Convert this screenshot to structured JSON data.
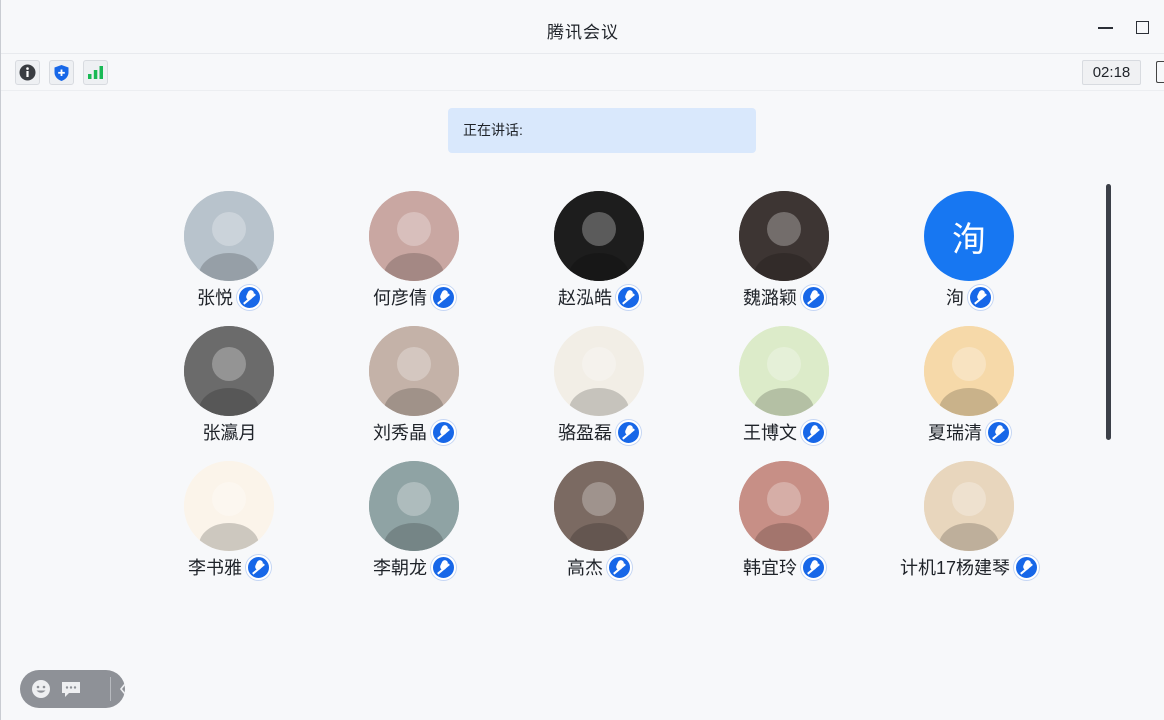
{
  "window": {
    "title": "腾讯会议"
  },
  "toolbar": {
    "info_icon": "info-icon",
    "shield_icon": "shield-icon",
    "signal_icon": "signal-bars-icon",
    "timer": "02:18"
  },
  "speaking": {
    "label": "正在讲话:"
  },
  "participants": [
    {
      "name": "张悦",
      "muted": true,
      "avatar_type": "image",
      "avatar_bg": "#b8c3cc"
    },
    {
      "name": "何彦倩",
      "muted": true,
      "avatar_type": "image",
      "avatar_bg": "#c9a7a2"
    },
    {
      "name": "赵泓皓",
      "muted": true,
      "avatar_type": "image",
      "avatar_bg": "#1d1d1d"
    },
    {
      "name": "魏潞颖",
      "muted": true,
      "avatar_type": "image",
      "avatar_bg": "#3d3533"
    },
    {
      "name": "洵",
      "muted": true,
      "avatar_type": "text",
      "avatar_text": "洵",
      "avatar_bg": "#1777f2"
    },
    {
      "name": "张瀛月",
      "muted": false,
      "avatar_type": "image",
      "avatar_bg": "#6b6b6b"
    },
    {
      "name": "刘秀晶",
      "muted": true,
      "avatar_type": "image",
      "avatar_bg": "#c4b2a8"
    },
    {
      "name": "骆盈磊",
      "muted": true,
      "avatar_type": "image",
      "avatar_bg": "#f2eee6"
    },
    {
      "name": "王博文",
      "muted": true,
      "avatar_type": "image",
      "avatar_bg": "#dcebc9"
    },
    {
      "name": "夏瑞清",
      "muted": true,
      "avatar_type": "image",
      "avatar_bg": "#f6d9a9"
    },
    {
      "name": "李书雅",
      "muted": true,
      "avatar_type": "image",
      "avatar_bg": "#fbf4ea"
    },
    {
      "name": "李朝龙",
      "muted": true,
      "avatar_type": "image",
      "avatar_bg": "#8fa3a4"
    },
    {
      "name": "高杰",
      "muted": true,
      "avatar_type": "image",
      "avatar_bg": "#7b6a62"
    },
    {
      "name": "韩宜玲",
      "muted": true,
      "avatar_type": "image",
      "avatar_bg": "#c78f86"
    },
    {
      "name": "计机17杨建琴",
      "muted": true,
      "avatar_type": "image",
      "avatar_bg": "#e8d6bd"
    }
  ],
  "bottom_bar": {
    "emoji_icon": "emoji-icon",
    "chat_icon": "chat-icon",
    "collapse_icon": "chevron-left-icon"
  },
  "colors": {
    "accent": "#1767e8",
    "speaking_bg": "#d9e8fc"
  }
}
